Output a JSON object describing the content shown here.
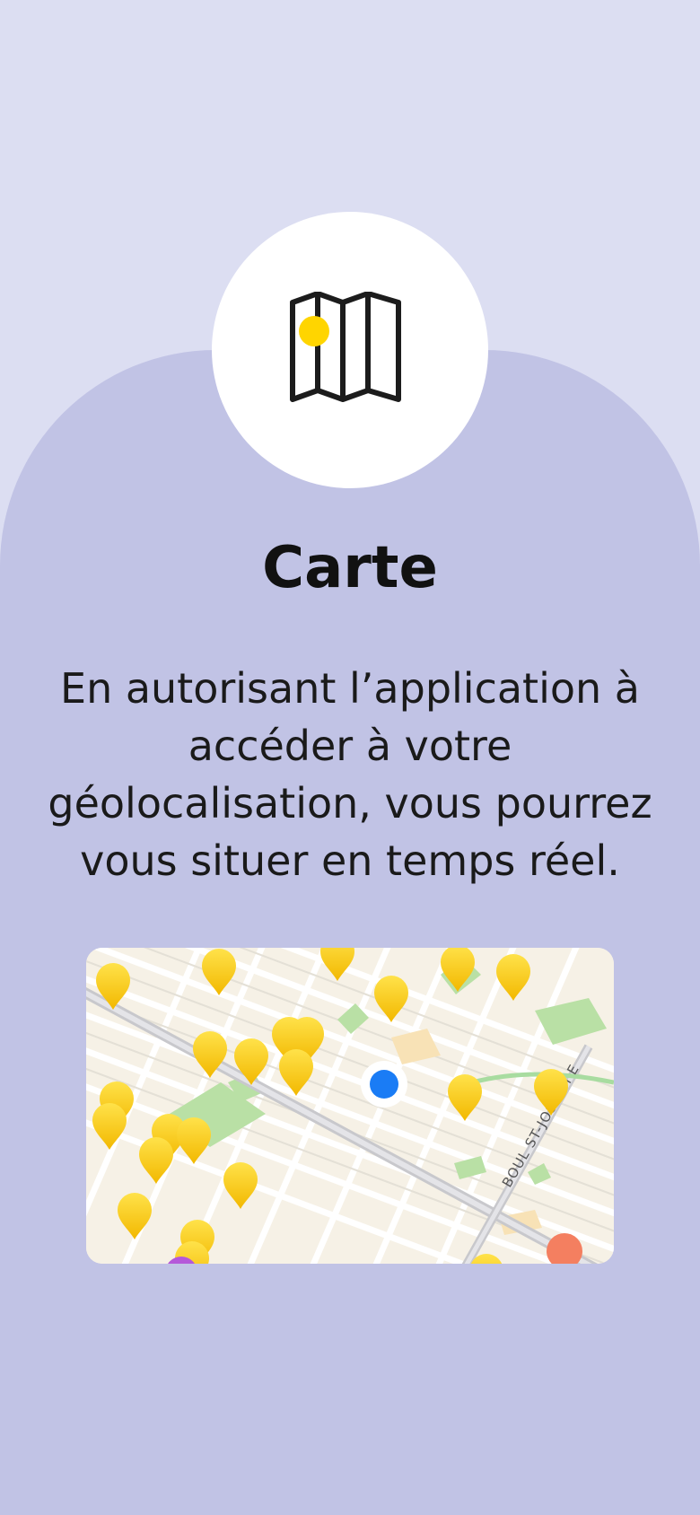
{
  "onboarding": {
    "icon": "folded-map-icon",
    "title": "Carte",
    "description": "En autorisant l’application à accéder à votre géolocalisation, vous pourrez vous situer en temps réel.",
    "map_preview": {
      "street_label": "BOUL ST-JOSEPH E",
      "user_location": "blue-dot"
    }
  },
  "colors": {
    "background_top": "#dcdef2",
    "panel": "#c1c3e5",
    "accent_yellow": "#ffd500",
    "user_dot": "#1a7cf5"
  }
}
